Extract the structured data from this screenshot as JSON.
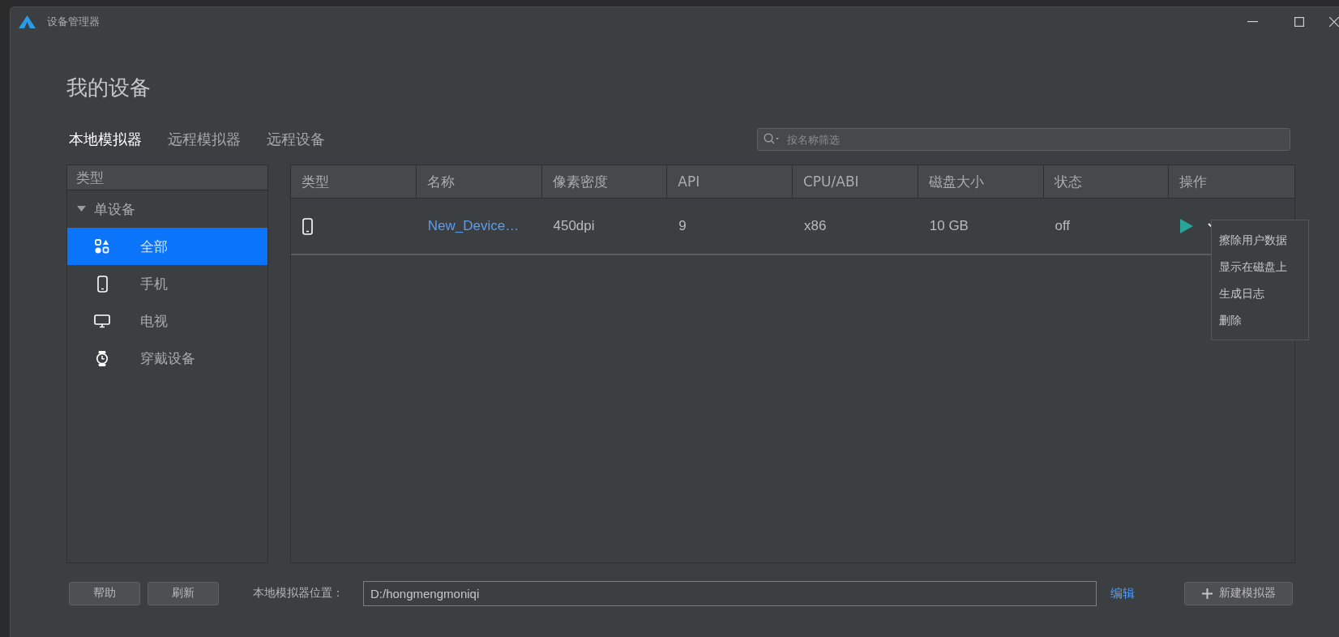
{
  "window": {
    "title": "设备管理器"
  },
  "heading": "我的设备",
  "tabs": [
    {
      "label": "本地模拟器",
      "selected": true
    },
    {
      "label": "远程模拟器",
      "selected": false
    },
    {
      "label": "远程设备",
      "selected": false
    }
  ],
  "search": {
    "placeholder": "按名称筛选"
  },
  "sidebar": {
    "header": "类型",
    "group": {
      "label": "单设备",
      "expanded": true,
      "items": [
        {
          "label": "全部",
          "kind": "all",
          "selected": true
        },
        {
          "label": "手机",
          "kind": "phone",
          "selected": false
        },
        {
          "label": "电视",
          "kind": "tv",
          "selected": false
        },
        {
          "label": "穿戴设备",
          "kind": "watch",
          "selected": false
        }
      ]
    }
  },
  "table": {
    "columns": [
      "类型",
      "名称",
      "像素密度",
      "API",
      "CPU/ABI",
      "磁盘大小",
      "状态",
      "操作"
    ],
    "rows": [
      {
        "kind": "phone",
        "name": "New_Device…",
        "density": "450dpi",
        "api": "9",
        "cpu_abi": "x86",
        "disk": "10 GB",
        "status": "off"
      }
    ]
  },
  "menu": {
    "items": [
      "擦除用户数据",
      "显示在磁盘上",
      "生成日志",
      "删除"
    ]
  },
  "footer": {
    "buttons": [
      "帮助",
      "刷新"
    ],
    "location_label": "本地模拟器位置：",
    "location_value": "D:/hongmengmoniqi",
    "edit_link": "编辑",
    "new_button": "新建模拟器"
  }
}
